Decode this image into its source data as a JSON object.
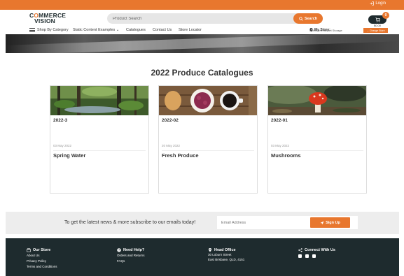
{
  "topbar": {
    "login_label": "Login"
  },
  "header": {
    "logo_line1": "COMMERCE",
    "logo_line2": "VISION",
    "search_placeholder": "Product Search",
    "search_button": "Search",
    "cart_count": "0",
    "cart_total": "$0.00"
  },
  "nav": {
    "shop_by_category": "Shop By Category",
    "static_content": "Static Content Examples ⌄",
    "catalogues": "Catalogues",
    "contact": "Contact Us",
    "store_locator": "Store Locator",
    "my_store_label": "My Store:",
    "my_store_value": "Melbourne Airport Storage",
    "change_store": "→ Change Store"
  },
  "main": {
    "title": "2022 Produce Catalogues",
    "cards": [
      {
        "category": "2022-3",
        "date": "03 May 2022",
        "title": "Spring Water",
        "image": "forest-stream-photo"
      },
      {
        "category": "2022-02",
        "date": "20 May 2022",
        "title": "Fresh Produce",
        "image": "breakfast-table-photo"
      },
      {
        "category": "2022-01",
        "date": "03 May 2022",
        "title": "Mushrooms",
        "image": "red-mushroom-photo"
      }
    ]
  },
  "subscribe": {
    "text": "To get the latest news & more subscribe to our emails today!",
    "email_placeholder": "Email Address",
    "button": "Sign Up"
  },
  "footer": {
    "our_store": {
      "heading": "Our Store",
      "links": [
        "About Us",
        "Privacy Policy",
        "Terms and Conditions"
      ]
    },
    "need_help": {
      "heading": "Need Help?",
      "links": [
        "Orders and Returns",
        "FAQs"
      ]
    },
    "head_office": {
      "heading": "Head Office",
      "lines": [
        "30 Loburn Street",
        "East Brisbane, QLD, 4151"
      ]
    },
    "connect": {
      "heading": "Connect With Us",
      "icons": [
        "instagram-icon",
        "facebook-icon",
        "youtube-icon"
      ]
    }
  },
  "colors": {
    "accent": "#e8772e",
    "dark": "#1e2b2e"
  }
}
